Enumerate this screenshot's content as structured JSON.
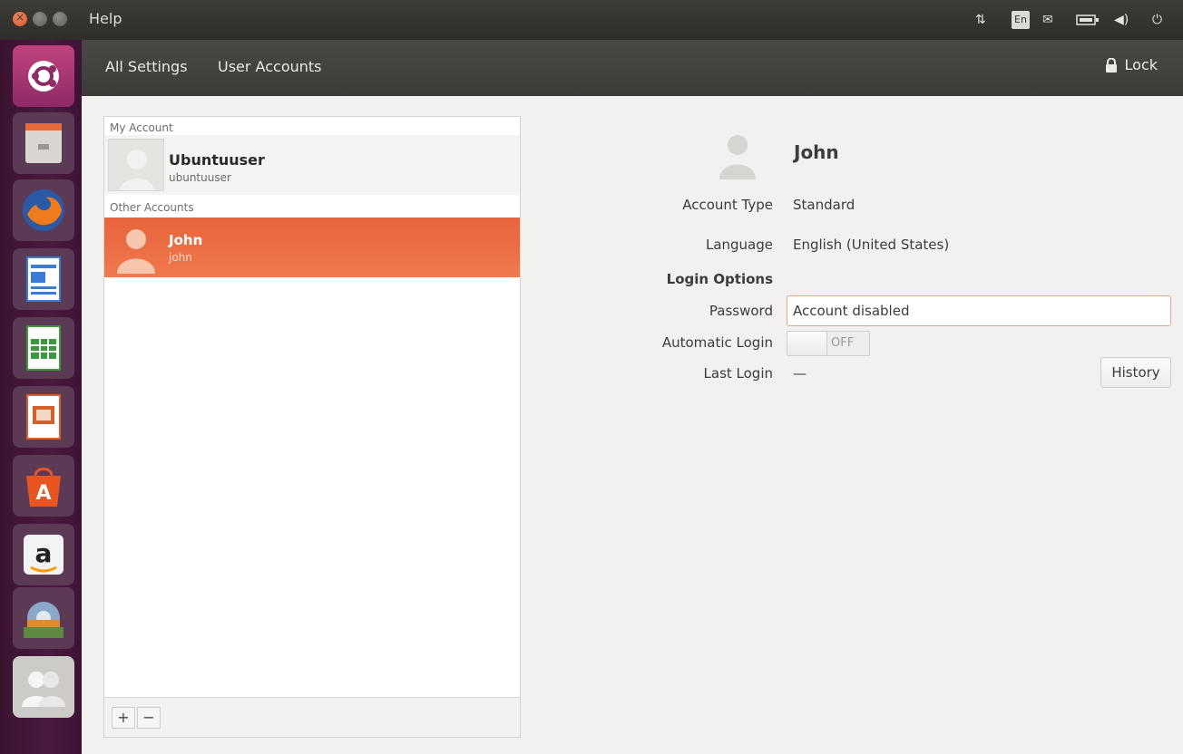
{
  "top_panel": {
    "app_menu": "Help",
    "lang_indicator": "En",
    "icons": [
      "close-icon",
      "minimize-icon",
      "maximize-icon",
      "network-icon",
      "keyboard-lang-icon",
      "mail-icon",
      "battery-icon",
      "volume-icon",
      "power-icon"
    ]
  },
  "launcher": {
    "items": [
      "ubuntu-dash-icon",
      "files-icon",
      "firefox-icon",
      "writer-icon",
      "calc-icon",
      "impress-icon",
      "software-center-icon",
      "amazon-icon",
      "system-settings-icon",
      "user-accounts-icon"
    ]
  },
  "header": {
    "crumbs": [
      "All Settings",
      "User Accounts"
    ],
    "lock_label": "Lock"
  },
  "user_list": {
    "my_account_label": "My Account",
    "my_account": {
      "name": "Ubuntuuser",
      "login": "ubuntuuser"
    },
    "other_accounts_label": "Other Accounts",
    "other_accounts": [
      {
        "name": "John",
        "login": "john"
      }
    ],
    "add_label": "+",
    "remove_label": "−"
  },
  "details": {
    "name": "John",
    "account_type_label": "Account Type",
    "account_type": "Standard",
    "language_label": "Language",
    "language": "English (United States)",
    "login_options_label": "Login Options",
    "password_label": "Password",
    "password_value": "Account disabled",
    "auto_login_label": "Automatic Login",
    "auto_login_state": "OFF",
    "last_login_label": "Last Login",
    "last_login_value": "—",
    "history_label": "History"
  },
  "colors": {
    "accent": "#e95420",
    "launcher": "#4b1a3f",
    "panel": "#3c3b37"
  }
}
